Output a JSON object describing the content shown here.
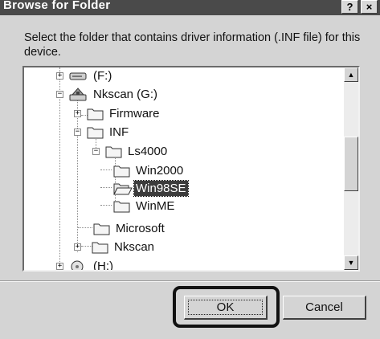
{
  "window": {
    "title": "Browse for Folder",
    "help_label": "?",
    "close_label": "×"
  },
  "prompt": "Select the folder that contains driver information (.INF file) for this device.",
  "tree": {
    "drive_f": "(F:)",
    "nkscan_drive": "Nkscan (G:)",
    "firmware": "Firmware",
    "inf": "INF",
    "ls4000": "Ls4000",
    "win2000": "Win2000",
    "win98se": "Win98SE",
    "winme": "WinME",
    "microsoft": "Microsoft",
    "nkscan": "Nkscan",
    "drive_h": "(H:)",
    "expand_sign": "+",
    "collapse_sign": "−"
  },
  "scrollbar": {
    "up_arrow": "▲",
    "down_arrow": "▼"
  },
  "buttons": {
    "ok": "OK",
    "cancel": "Cancel"
  },
  "colors": {
    "selection": "#3c3c3c",
    "titlebar": "#4a4a4a",
    "highlight_ring": "#111111"
  }
}
